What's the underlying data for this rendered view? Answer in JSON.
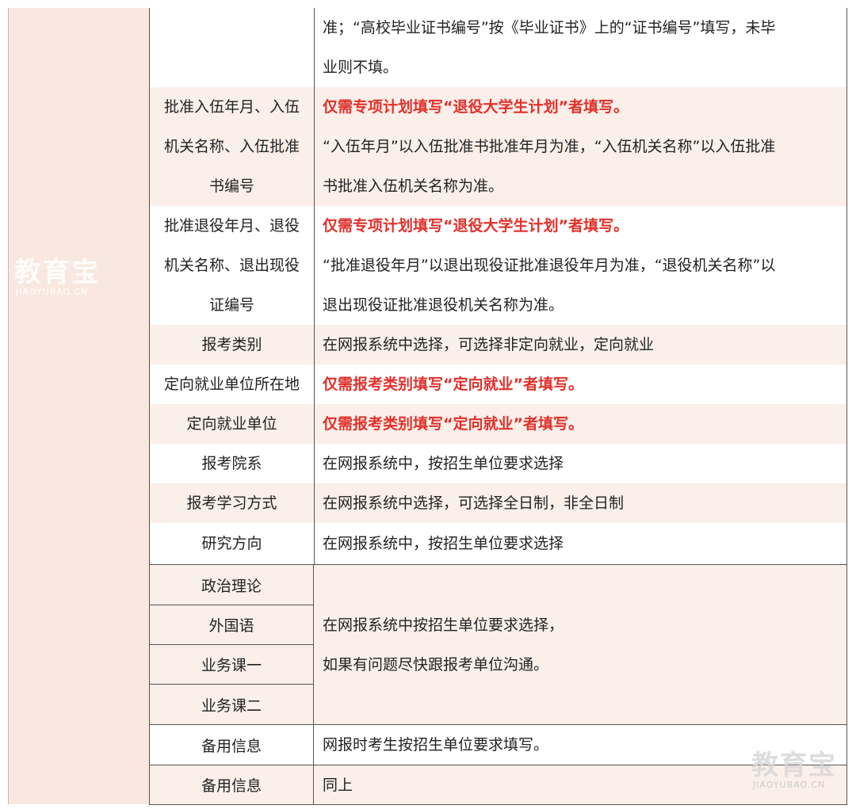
{
  "watermark": {
    "brand": "教育宝",
    "domain": "JIAOYUBAO.CN"
  },
  "rows": [
    {
      "label": "",
      "lines": [
        "准；“高校毕业证书编号”按《毕业证书》上的“证书编号”填写，未毕",
        "业则不填。"
      ],
      "red": ""
    },
    {
      "label": "批准入伍年月、入伍机关名称、入伍批准书编号",
      "label_lines": [
        "批准入伍年月、入伍",
        "机关名称、入伍批准",
        "书编号"
      ],
      "red": "仅需专项计划填写“退役大学生计划”者填写。",
      "lines": [
        "“入伍年月”以入伍批准书批准年月为准，“入伍机关名称”以入伍批准",
        "书批准入伍机关名称为准。"
      ]
    },
    {
      "label_lines": [
        "批准退役年月、退役",
        "机关名称、退出现役",
        "证编号"
      ],
      "red": "仅需专项计划填写“退役大学生计划”者填写。",
      "lines": [
        "“批准退役年月”以退出现役证批准退役年月为准，“退役机关名称”以",
        "退出现役证批准退役机关名称为准。"
      ]
    },
    {
      "label": "报考类别",
      "text": "在网报系统中选择，可选择非定向就业，定向就业"
    },
    {
      "label": "定向就业单位所在地",
      "red": "仅需报考类别填写“定向就业”者填写。"
    },
    {
      "label": "定向就业单位",
      "red": "仅需报考类别填写“定向就业”者填写。"
    },
    {
      "label": "报考院系",
      "text": "在网报系统中，按招生单位要求选择"
    },
    {
      "label": "报考学习方式",
      "text": "在网报系统中选择，可选择全日制，非全日制"
    },
    {
      "label": "研究方向",
      "text": "在网报系统中，按招生单位要求选择"
    }
  ],
  "merged": {
    "labels": [
      "政治理论",
      "外国语",
      "业务课一",
      "业务课二"
    ],
    "lines": [
      "在网报系统中按招生单位要求选择，",
      "如果有问题尽快跟报考单位沟通。"
    ]
  },
  "tail": [
    {
      "label": "备用信息",
      "text": "网报时考生按招生单位要求填写。"
    },
    {
      "label": "备用信息",
      "text": "同上"
    }
  ]
}
